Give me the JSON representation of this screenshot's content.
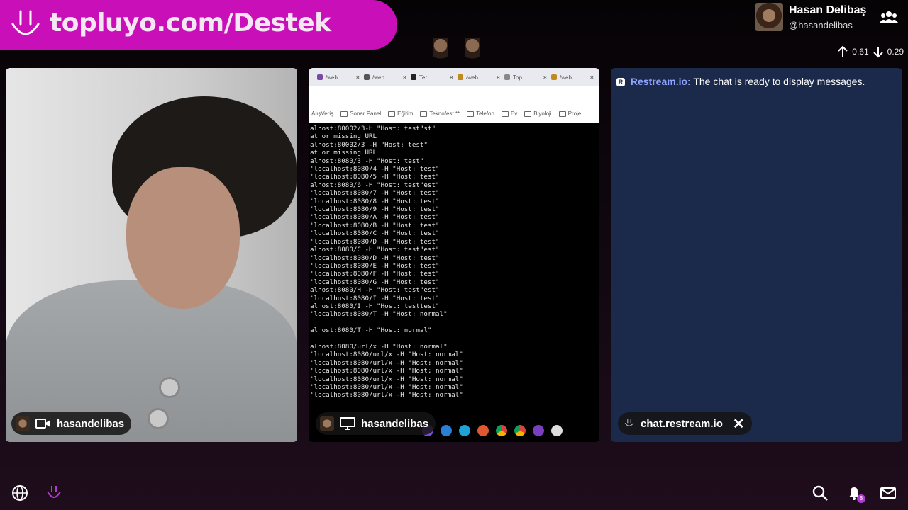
{
  "banner": {
    "text": "topluyo.com/Destek"
  },
  "profile": {
    "name": "Hasan Delibaş",
    "handle": "@hasandelibas"
  },
  "stats": {
    "up": "0.61",
    "down": "0.29"
  },
  "camera_panel": {
    "user": "hasandelibas"
  },
  "screen_panel": {
    "user": "hasandelibas",
    "tabs": [
      "/web",
      "/web",
      "Ter",
      "/web",
      "Top",
      "/web"
    ],
    "bookmarks": [
      "AlışVeriş",
      "Sonar Panel",
      "Eğitim",
      "Teknofest **",
      "Telefon",
      "Ev",
      "Biyoloji",
      "Proje"
    ],
    "terminal_lines": [
      "alhost:80002/3-H \"Host: test\"st\"",
      "at or missing URL",
      "alhost:80002/3 -H \"Host: test\"",
      "at or missing URL",
      "alhost:8080/3 -H \"Host: test\"",
      "'localhost:8080/4 -H \"Host: test\"",
      "'localhost:8080/5 -H \"Host: test\"",
      "alhost:8080/6 -H \"Host: test\"est\"",
      "'localhost:8080/7 -H \"Host: test\"",
      "'localhost:8080/8 -H \"Host: test\"",
      "'localhost:8080/9 -H \"Host: test\"",
      "'localhost:8080/A -H \"Host: test\"",
      "'localhost:8080/B -H \"Host: test\"",
      "'localhost:8080/C -H \"Host: test\"",
      "'localhost:8080/D -H \"Host: test\"",
      "alhost:8080/C -H \"Host: test\"est\"",
      "'localhost:8080/D -H \"Host: test\"",
      "'localhost:8080/E -H \"Host: test\"",
      "'localhost:8080/F -H \"Host: test\"",
      "'localhost:8080/G -H \"Host: test\"",
      "alhost:8080/H -H \"Host: test\"est\"",
      "'localhost:8080/I -H \"Host: test\"",
      "alhost:8080/I -H \"Host: testtest\"",
      "'localhost:8080/T -H \"Host: normal\"",
      "",
      "alhost:8080/T -H \"Host: normal\"",
      "",
      "alhost:8080/url/x -H \"Host: normal\"",
      "'localhost:8080/url/x -H \"Host: normal\"",
      "'localhost:8080/url/x -H \"Host: normal\"",
      "'localhost:8080/url/x -H \"Host: normal\"",
      "'localhost:8080/url/x -H \"Host: normal\"",
      "'localhost:8080/url/x -H \"Host: normal\"",
      "'localhost:8080/url/x -H \"Host: normal\""
    ]
  },
  "chat_panel": {
    "badge": "R",
    "sender": "Restream.io:",
    "message": "The chat is ready to display messages.",
    "source": "chat.restream.io"
  },
  "notifications": {
    "count": "8"
  },
  "colors": {
    "brand": "#c90fb8",
    "chat_bg": "#1b2a4b",
    "accent": "#8fa4ff"
  }
}
